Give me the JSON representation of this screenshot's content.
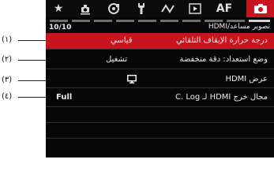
{
  "tabs": [
    {
      "name": "star-tab",
      "icon": "star-icon",
      "glyph": "★"
    },
    {
      "name": "shooting-tab",
      "icon": "camera-settings-icon"
    },
    {
      "name": "display-tab",
      "icon": "display-settings-icon"
    },
    {
      "name": "wrench-tab",
      "icon": "wrench-icon"
    },
    {
      "name": "network-tab",
      "icon": "network-icon"
    },
    {
      "name": "playback-tab",
      "icon": "playback-icon",
      "glyph": "▶"
    },
    {
      "name": "af-tab",
      "label": "AF"
    },
    {
      "name": "camera-tab",
      "icon": "camera-icon",
      "active": true
    }
  ],
  "header": {
    "page_count": "10/10",
    "section_title": "تصوير مساعد/HDMI"
  },
  "menu": {
    "items": [
      {
        "label": "درجة حرارة الإيقاف التلقائي",
        "value": "قياسي"
      },
      {
        "label": "وضع استعداد: دقة منخفضة",
        "value": "تشغيل"
      },
      {
        "label": "عرض HDMI",
        "value_icon": "monitor-icon"
      },
      {
        "label": "مجال خرج HDMI لـ C. Log",
        "value": "Full"
      }
    ]
  },
  "callouts": [
    "(١)",
    "(٢)",
    "(٣)",
    "(٤)"
  ],
  "colors": {
    "accent_red": "#c8141e",
    "background": "#060606",
    "text": "#ececec"
  }
}
